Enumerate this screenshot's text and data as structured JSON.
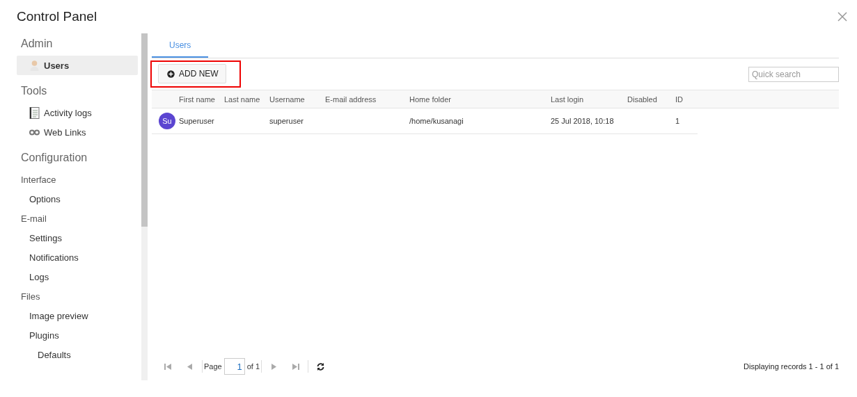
{
  "window": {
    "title": "Control Panel"
  },
  "sidebar": {
    "sections": [
      {
        "title": "Admin",
        "items": [
          {
            "label": "Users",
            "selected": true
          }
        ]
      },
      {
        "title": "Tools",
        "items": [
          {
            "label": "Activity logs",
            "selected": false
          },
          {
            "label": "Web Links",
            "selected": false
          }
        ]
      },
      {
        "title": "Configuration",
        "items": [
          {
            "label": "Interface",
            "selected": false,
            "children": [
              {
                "label": "Options",
                "selected": false
              }
            ]
          },
          {
            "label": "E-mail",
            "selected": false,
            "children": [
              {
                "label": "Settings",
                "selected": false
              },
              {
                "label": "Notifications",
                "selected": false
              },
              {
                "label": "Logs",
                "selected": false
              }
            ]
          },
          {
            "label": "Files",
            "selected": false,
            "children": [
              {
                "label": "Image preview",
                "selected": false
              },
              {
                "label": "Plugins",
                "selected": false,
                "children": [
                  {
                    "label": "Defaults",
                    "selected": false
                  }
                ]
              }
            ]
          }
        ]
      }
    ]
  },
  "tabs": [
    {
      "label": "Users",
      "selected": true
    }
  ],
  "toolbar": {
    "add_button": {
      "label": "ADD NEW",
      "highlighted": true
    },
    "search": {
      "placeholder": "Quick search"
    }
  },
  "table": {
    "columns": [
      "First name",
      "Last name",
      "Username",
      "E-mail address",
      "Home folder",
      "Last login",
      "Disabled",
      "ID"
    ],
    "rows": [
      {
        "avatar": "Su",
        "color": "#5b45d1",
        "cells": [
          "Superuser",
          "",
          "superuser",
          "",
          "/home/kusanagi",
          "25 Jul 2018, 10:18",
          "",
          "1"
        ]
      }
    ]
  },
  "pager": {
    "page_label": "Page",
    "page": "1",
    "of": "of 1",
    "status": "Displaying records 1 - 1 of 1"
  }
}
